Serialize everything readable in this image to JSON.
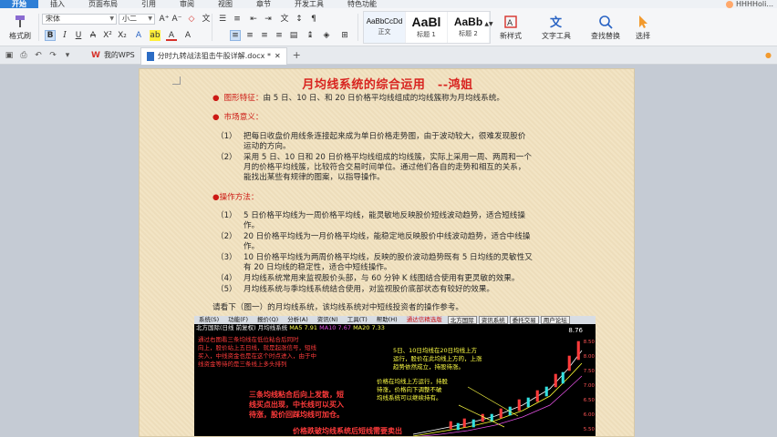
{
  "menubar": {
    "tabs": [
      "开始",
      "插入",
      "页面布局",
      "引用",
      "审阅",
      "视图",
      "章节",
      "开发工具",
      "特色功能"
    ],
    "active_tab": "开始",
    "user_name": "HHHHoli..."
  },
  "ribbon": {
    "format_painter": "格式刷",
    "font_name": "宋体",
    "font_size": "小二",
    "bold": "B",
    "italic": "I",
    "underline": "U",
    "styles": [
      {
        "sample": "AaBbCcDd",
        "name": "正文"
      },
      {
        "sample": "AaBl",
        "name": "标题 1"
      },
      {
        "sample": "AaBb",
        "name": "标题 2"
      }
    ],
    "new_style": "新样式",
    "text_tools": "文字工具",
    "find_replace": "查找替换",
    "select": "选择"
  },
  "tabbar": {
    "home_tab": "我的WPS",
    "doc_tab": "分时九转战法狙击牛股详解.docx *",
    "plus": "+"
  },
  "document": {
    "title": "月均线系统的综合运用　--鸿姐",
    "feature_label": "图形特征：",
    "feature_text": "由 5 日、10 日、和 20 日价格平均线组成的均线簇称为月均线系统。",
    "market_label": "市场意义：",
    "market_items": [
      {
        "num": "（1）",
        "lines": [
          "把每日收盘价用线条连接起来成为单日价格走势图，由于波动较大，很难发现股价",
          "运动的方向。"
        ]
      },
      {
        "num": "（2）",
        "lines": [
          "采用 5 日、10 日和 20 日价格平均线组成的均线簇，实际上采用一周、两周和一个",
          "月的价格平均线簇，比较符合交易时间单位。通过他们各自的走势和相互的关系，",
          "能找出某些有规律的图案，以指导操作。"
        ]
      }
    ],
    "method_label": "操作方法：",
    "method_items": [
      {
        "num": "（1）",
        "lines": [
          "5 日价格平均线为一周价格平均线，能灵敏地反映股价短线波动趋势，适合短线操",
          "作。"
        ]
      },
      {
        "num": "（2）",
        "lines": [
          "20 日价格平均线为一月价格平均线，能稳定地反映股价中线波动趋势，适合中线操",
          "作。"
        ]
      },
      {
        "num": "（3）",
        "lines": [
          "10 日价格平均线为两周价格平均线，反映的股价波动趋势既有 5 日均线的灵敏性又",
          "有 20 日均线的稳定性，适合中短线操作。"
        ]
      },
      {
        "num": "（4）",
        "lines": [
          "月均线系统常用来监视股价头部，与 60 分钟 K 线图结合使用有更灵敏的效果。"
        ]
      },
      {
        "num": "（5）",
        "lines": [
          "月均线系统与季均线系统结合使用，对监视股价底部状态有较好的效果。"
        ]
      }
    ],
    "see_text": "请看下（图一）的月均线系统，该均线系统对中短线投资者的操作参考。"
  },
  "stock_chart": {
    "menu": [
      "系统(S)",
      "功能(F)",
      "报价(Q)",
      "分析(A)",
      "资讯(N)",
      "工具(T)",
      "帮助(H)"
    ],
    "menu_highlight": "通达信精选版",
    "menu_buttons": [
      "北方国际",
      "资讯系统",
      "委托交易",
      "用户论坛"
    ],
    "info_name": "北方国际(日线 前复权) 月均线系统",
    "info_ma5": "MA5 7.91",
    "info_ma10": "MA10 7.67",
    "info_ma20": "MA20 7.33",
    "notes": [
      "通过右图看三条均线在低位粘合后同时",
      "向上，股价站上五日线，就是起涨信号，短线",
      "买入，中线资金也是在这个时点进入，由于中",
      "线资金等待的是三条线上多头排列"
    ],
    "note_right": [
      "5日、10日均线在20日均线上方",
      "运行，股价在此均线上方的，上涨",
      "趋势依然成立，持股待涨。"
    ],
    "note_mid": [
      "价格在均线上方运行，持股",
      "待涨，价格向下调整不破",
      "均线系统可以继续持有。"
    ],
    "note_bottom": [
      "三条均线粘合后向上发散，短",
      "线买点出现，中长线可以买入",
      "待涨，股价回踩均线可加仓。"
    ],
    "note_last": "价格跌破均线系统后短线需要卖出",
    "price": "8.76",
    "scale": [
      "8.50",
      "8.00",
      "7.50",
      "7.00",
      "6.50",
      "6.00",
      "5.50"
    ]
  }
}
